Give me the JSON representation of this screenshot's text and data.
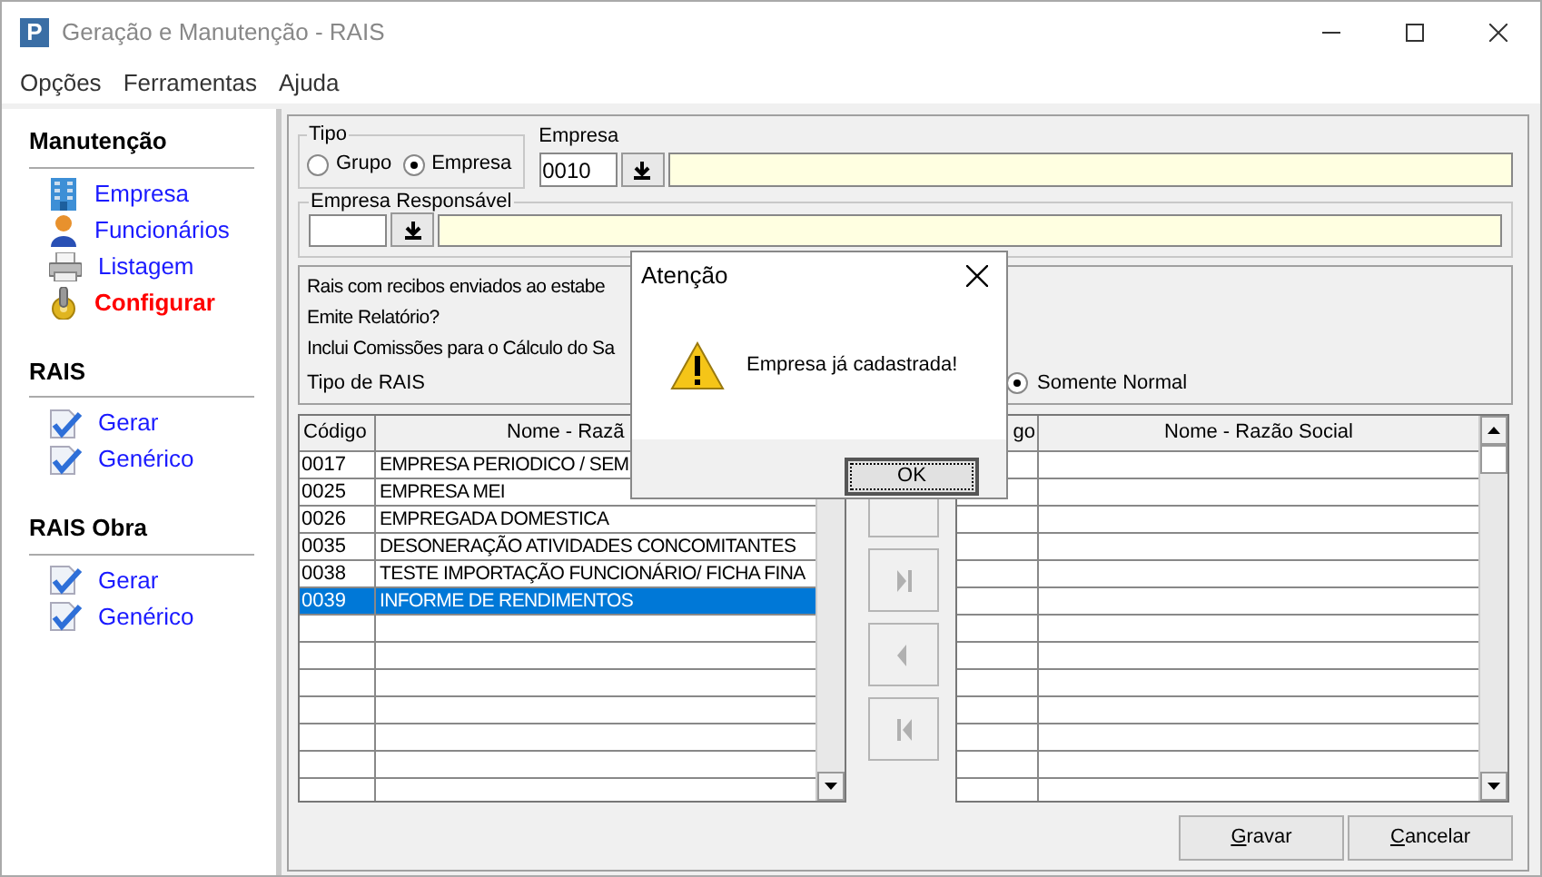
{
  "window": {
    "logo": "P",
    "title": "Geração e Manutenção - RAIS"
  },
  "menu": [
    "Opções",
    "Ferramentas",
    "Ajuda"
  ],
  "sidebar": [
    {
      "title": "Manutenção",
      "items": [
        {
          "label": "Empresa",
          "kind": "building",
          "selected": false
        },
        {
          "label": "Funcionários",
          "kind": "person",
          "selected": false
        },
        {
          "label": "Listagem",
          "kind": "printer",
          "selected": false
        },
        {
          "label": "Configurar",
          "kind": "config",
          "selected": true
        }
      ]
    },
    {
      "title": "RAIS",
      "items": [
        {
          "label": "Gerar",
          "kind": "check",
          "selected": false
        },
        {
          "label": "Genérico",
          "kind": "check",
          "selected": false
        }
      ]
    },
    {
      "title": "RAIS Obra",
      "items": [
        {
          "label": "Gerar",
          "kind": "check",
          "selected": false
        },
        {
          "label": "Genérico",
          "kind": "check",
          "selected": false
        }
      ]
    }
  ],
  "tipo": {
    "label": "Tipo",
    "options": [
      {
        "label": "Grupo",
        "selected": false
      },
      {
        "label": "Empresa",
        "selected": true
      }
    ]
  },
  "empresa": {
    "label": "Empresa",
    "code": "0010"
  },
  "empresa_responsavel": {
    "label": "Empresa Responsável"
  },
  "options": {
    "lines": [
      "Rais com recibos enviados ao estabe",
      "Emite Relatório?",
      "Inclui Comissões para o Cálculo do Sa"
    ],
    "tipo_label": "Tipo de RAIS",
    "tipo_radio": {
      "label": "Somente Normal",
      "selected": true
    }
  },
  "left_table": {
    "columns": [
      "Código",
      "Nome - Razã"
    ],
    "rows": [
      {
        "cells": [
          "0017",
          "EMPRESA PERIODICO / SEM"
        ],
        "selected": false
      },
      {
        "cells": [
          "0025",
          "EMPRESA MEI"
        ],
        "selected": false
      },
      {
        "cells": [
          "0026",
          "EMPREGADA DOMESTICA"
        ],
        "selected": false
      },
      {
        "cells": [
          "0035",
          "DESONERAÇÃO ATIVIDADES CONCOMITANTES"
        ],
        "selected": false
      },
      {
        "cells": [
          "0038",
          "TESTE IMPORTAÇÃO FUNCIONÁRIO/ FICHA FINA"
        ],
        "selected": false
      },
      {
        "cells": [
          "0039",
          "INFORME DE RENDIMENTOS"
        ],
        "selected": true
      }
    ]
  },
  "move_buttons": [
    {
      "kind": "covered"
    },
    {
      "kind": "last",
      "disabled": true
    },
    {
      "kind": "previous",
      "disabled": true
    },
    {
      "kind": "first",
      "disabled": true
    }
  ],
  "right_table": {
    "columns": [
      "go",
      "Nome - Razão Social"
    ]
  },
  "buttons": [
    "Gravar",
    "Cancelar"
  ],
  "dialog": {
    "title": "Atenção",
    "message": "Empresa já cadastrada!",
    "button": "OK"
  }
}
